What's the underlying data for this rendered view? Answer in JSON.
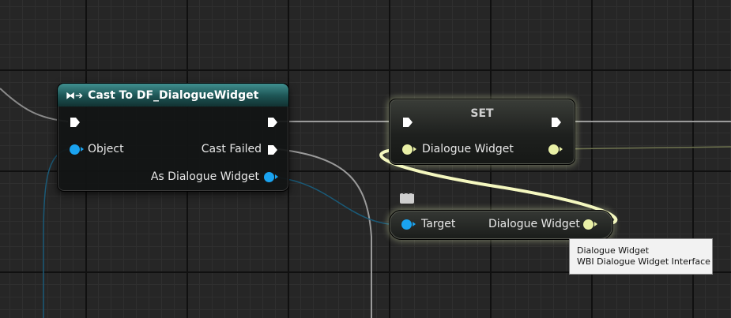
{
  "cast_node": {
    "title": "Cast To DF_DialogueWidget",
    "object_pin": "Object",
    "cast_failed_pin": "Cast Failed",
    "as_pin": "As Dialogue Widget",
    "header_icon": "cast-icon",
    "header_color": "#1d5353"
  },
  "set_node": {
    "title": "SET",
    "var_pin": "Dialogue Widget"
  },
  "getter_node": {
    "target_pin": "Target",
    "output_pin": "Dialogue Widget"
  },
  "tooltip": {
    "line1": "Dialogue Widget",
    "line2": "WBI Dialogue Widget Interface"
  },
  "colors": {
    "object_pin": "#1aa3f0",
    "interface_pin": "#e9f0a6",
    "exec_pin": "#ffffff",
    "background": "#262626"
  }
}
